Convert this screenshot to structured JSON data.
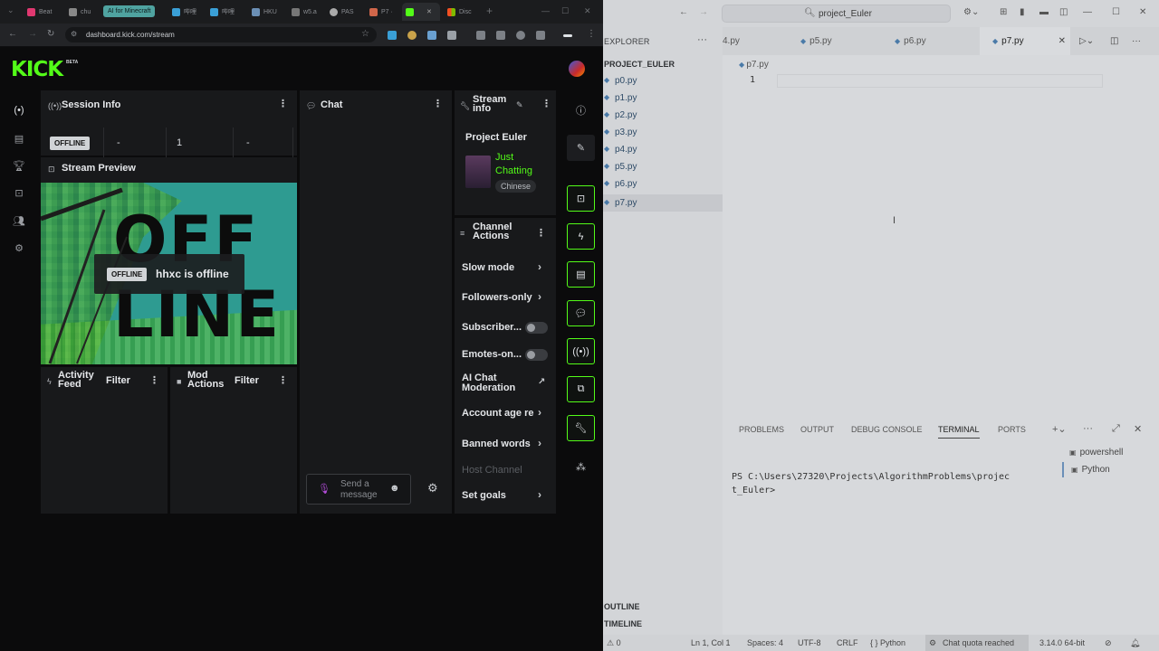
{
  "browser": {
    "tabs": [
      {
        "label": "Beat"
      },
      {
        "label": "chu"
      },
      {
        "label": "AI for Minecraft"
      },
      {
        "label": "哔哩"
      },
      {
        "label": "哔哩"
      },
      {
        "label": "HKU"
      },
      {
        "label": "w5.a"
      },
      {
        "label": "PAS"
      },
      {
        "label": "P7 ·"
      },
      {
        "label": ""
      },
      {
        "label": "Disc"
      }
    ],
    "new_tab": "+",
    "url": "dashboard.kick.com/stream"
  },
  "kick": {
    "logo": "KICK",
    "beta": "BETA",
    "session": {
      "title": "Session Info",
      "status": "OFFLINE",
      "stat1": "-",
      "stat2": "1",
      "stat3": "-"
    },
    "preview": {
      "title": "Stream Preview",
      "big_line1": "OFF",
      "big_line2": "LINE",
      "badge": "OFFLINE",
      "message": "hhxc is offline"
    },
    "chat": {
      "title": "Chat",
      "placeholder_line1": "Send a",
      "placeholder_line2": "message"
    },
    "stream_info": {
      "title_line1": "Stream",
      "title_line2": "info",
      "stream_title": "Project Euler",
      "category_line1": "Just",
      "category_line2": "Chatting",
      "language": "Chinese"
    },
    "channel_actions": {
      "title_line1": "Channel",
      "title_line2": "Actions",
      "items": [
        {
          "label": "Slow mode"
        },
        {
          "label": "Followers-only"
        },
        {
          "label": "Subscriber..."
        },
        {
          "label": "Emotes-on..."
        },
        {
          "label": "AI Chat Moderation"
        },
        {
          "label": "Account age re"
        },
        {
          "label": "Banned words"
        },
        {
          "label": "Host Channel"
        },
        {
          "label": "Set goals"
        }
      ]
    },
    "activity": {
      "title_line1": "Activity",
      "title_line2": "Feed",
      "filter": "Filter"
    },
    "mod_actions": {
      "title_line1": "Mod",
      "title_line2": "Actions",
      "filter": "Filter"
    },
    "accent": "#53fc18"
  },
  "vscode": {
    "search": "project_Euler",
    "explorer_title": "EXPLORER",
    "project": "PROJECT_EULER",
    "files": [
      "p0.py",
      "p1.py",
      "p2.py",
      "p3.py",
      "p4.py",
      "p5.py",
      "p6.py",
      "p7.py"
    ],
    "tabs": [
      "4.py",
      "p5.py",
      "p6.py",
      "p7.py"
    ],
    "breadcrumb": "p7.py",
    "line_number": "1",
    "panel_tabs": [
      "PROBLEMS",
      "OUTPUT",
      "DEBUG CONSOLE",
      "TERMINAL",
      "PORTS"
    ],
    "terminal_line1": "PS C:\\Users\\27320\\Projects\\AlgorithmProblems\\projec",
    "terminal_line2": "t_Euler>",
    "terminals": [
      "powershell",
      "Python"
    ],
    "outline": "OUTLINE",
    "timeline": "TIMELINE",
    "status": {
      "problems": "⚠ 0",
      "position": "Ln 1, Col 1",
      "spaces": "Spaces: 4",
      "encoding": "UTF-8",
      "eol": "CRLF",
      "language": "{ } Python",
      "quota": "Chat quota reached",
      "interpreter": "3.14.0 64-bit"
    }
  }
}
